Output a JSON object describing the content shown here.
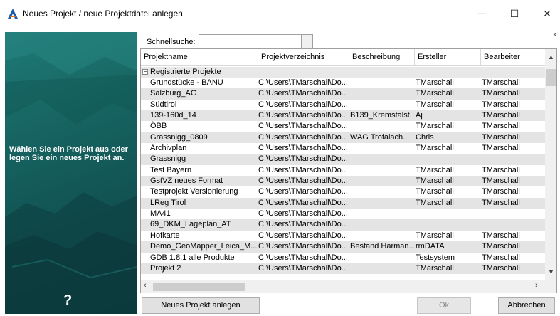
{
  "window": {
    "title": "Neues Projekt / neue Projektdatei anlegen",
    "minimize_icon": "—",
    "maximize_icon": "☐",
    "close_icon": "✕"
  },
  "side_panel": {
    "message": "Wählen Sie ein Projekt aus oder legen Sie ein neues Projekt an.",
    "help_icon": "?"
  },
  "search": {
    "label": "Schnellsuche:",
    "value": "",
    "button_label": "..."
  },
  "more_icon": "»",
  "grid": {
    "columns": [
      "Projektname",
      "Projektverzeichnis",
      "Beschreibung",
      "Ersteller",
      "Bearbeiter"
    ],
    "group_toggle": "−",
    "group_label": "Registrierte Projekte",
    "rows": [
      [
        "Grundstücke - BANU",
        "C:\\Users\\TMarschall\\Do...",
        "",
        "TMarschall",
        "TMarschall"
      ],
      [
        "Salzburg_AG",
        "C:\\Users\\TMarschall\\Do...",
        "",
        "TMarschall",
        "TMarschall"
      ],
      [
        "Südtirol",
        "C:\\Users\\TMarschall\\Do...",
        "",
        "TMarschall",
        "TMarschall"
      ],
      [
        "139-160d_14",
        "C:\\Users\\TMarschall\\Do...",
        "B139_Kremstalst...",
        "Aj",
        "TMarschall"
      ],
      [
        "ÖBB",
        "C:\\Users\\TMarschall\\Do...",
        "",
        "TMarschall",
        "TMarschall"
      ],
      [
        "Grassnigg_0809",
        "C:\\Users\\TMarschall\\Do...",
        "WAG Trofaiach...",
        "Chris",
        "TMarschall"
      ],
      [
        "Archivplan",
        "C:\\Users\\TMarschall\\Do...",
        "",
        "TMarschall",
        "TMarschall"
      ],
      [
        "Grassnigg",
        "C:\\Users\\TMarschall\\Do...",
        "",
        "",
        ""
      ],
      [
        "Test Bayern",
        "C:\\Users\\TMarschall\\Do...",
        "",
        "TMarschall",
        "TMarschall"
      ],
      [
        "GstVZ neues Format",
        "C:\\Users\\TMarschall\\Do...",
        "",
        "TMarschall",
        "TMarschall"
      ],
      [
        "Testprojekt Versionierung",
        "C:\\Users\\TMarschall\\Do...",
        "",
        "TMarschall",
        "TMarschall"
      ],
      [
        "LReg Tirol",
        "C:\\Users\\TMarschall\\Do...",
        "",
        "TMarschall",
        "TMarschall"
      ],
      [
        "MA41",
        "C:\\Users\\TMarschall\\Do...",
        "",
        "",
        ""
      ],
      [
        "69_DKM_Lageplan_AT",
        "C:\\Users\\TMarschall\\Do...",
        "",
        "",
        ""
      ],
      [
        "Hofkarte",
        "C:\\Users\\TMarschall\\Do...",
        "",
        "TMarschall",
        "TMarschall"
      ],
      [
        "Demo_GeoMapper_Leica_M...",
        "C:\\Users\\TMarschall\\Do...",
        "Bestand Harman...",
        "rmDATA",
        "TMarschall"
      ],
      [
        "GDB 1.8.1 alle Produkte",
        "C:\\Users\\TMarschall\\Do...",
        "",
        "Testsystem",
        "TMarschall"
      ],
      [
        "Projekt 2",
        "C:\\Users\\TMarschall\\Do...",
        "",
        "TMarschall",
        "TMarschall"
      ]
    ]
  },
  "buttons": {
    "new_project": "Neues Projekt anlegen",
    "ok": "Ok",
    "cancel": "Abbrechen"
  },
  "colors": {
    "side_panel": "#15605e",
    "row_alt": "#e4e4e4",
    "group_row": "#e8e8e8"
  }
}
